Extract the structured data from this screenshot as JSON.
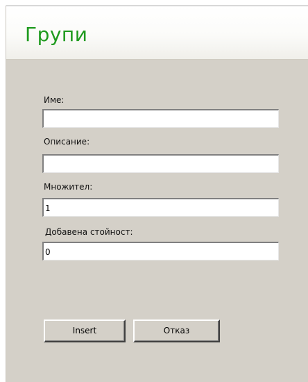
{
  "header": {
    "title": "Групи"
  },
  "form": {
    "name": {
      "label": "Име:",
      "value": ""
    },
    "description": {
      "label": "Описание:",
      "value": ""
    },
    "multiplier": {
      "label": "Множител:",
      "value": "1"
    },
    "added_value": {
      "label": "Добавена стойност:",
      "value": "0"
    }
  },
  "buttons": {
    "insert_label": "Insert",
    "cancel_label": "Отказ"
  },
  "colors": {
    "title": "#1e9a1e",
    "panel_background": "#d4d0c8"
  }
}
